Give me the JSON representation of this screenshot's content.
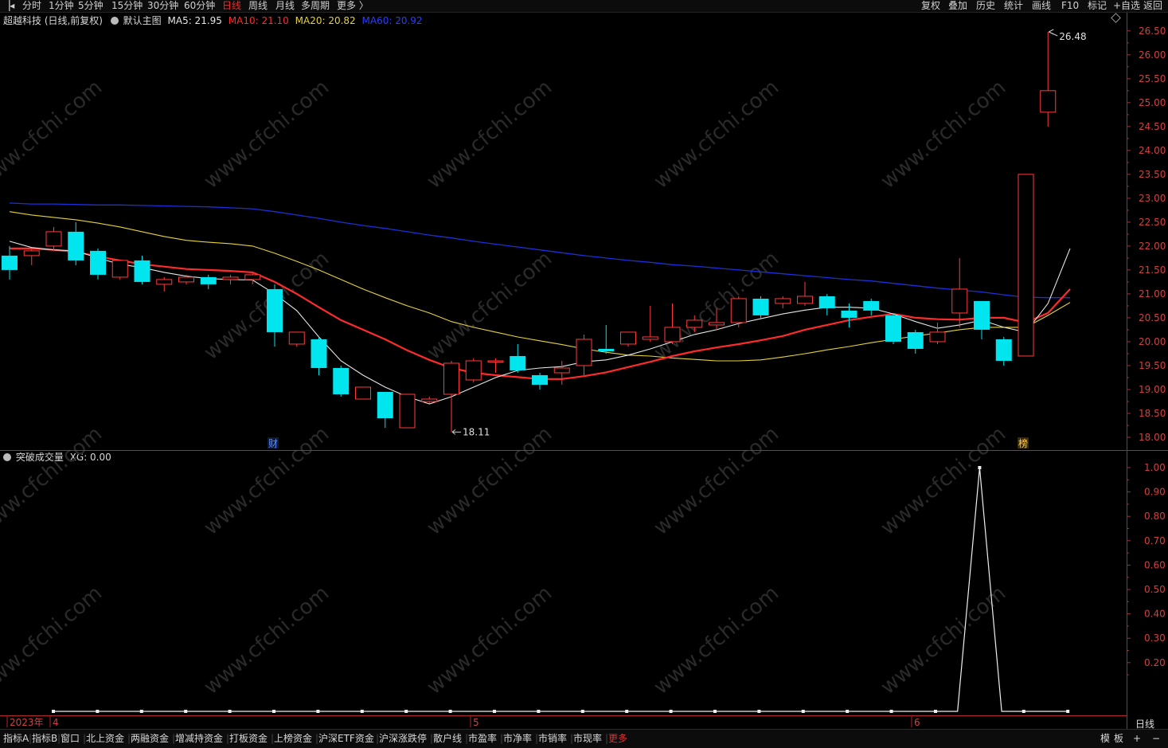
{
  "toolbar": {
    "back_icon": "chevron-left-icon",
    "periods": [
      "分时",
      "1分钟",
      "5分钟",
      "15分钟",
      "30分钟",
      "60分钟",
      "日线",
      "周线",
      "月线",
      "多周期",
      "更多 〉"
    ],
    "active_period": "日线",
    "right_buttons": [
      "复权",
      "叠加",
      "历史",
      "统计",
      "画线",
      "F10",
      "标记",
      "+自选",
      "返回"
    ]
  },
  "main_legend": {
    "stock": "超越科技 (日线,前复权)",
    "template_label": "默认主图",
    "ma5": "MA5: 21.95",
    "ma10": "MA10: 21.10",
    "ma20": "MA20: 20.82",
    "ma60": "MA60: 20.92",
    "colors": {
      "ma5": "#e6e6e6",
      "ma10": "#ff2b2b",
      "ma20": "#e6d23a",
      "ma60": "#1c2fd8",
      "up": "#ff3a3a",
      "down": "#00e5ee"
    }
  },
  "annotations": {
    "high": "26.48",
    "low": "18.11",
    "fin_marker": "财",
    "rank_marker": "榜"
  },
  "sub_legend": {
    "name": "突破成交量",
    "xg": "XG: 0.00"
  },
  "x_labels": {
    "start": "2023年",
    "m4": "4",
    "m5": "5",
    "m6": "6"
  },
  "corner_label": "日线",
  "bottom_buttons": [
    "指标A",
    "指标B",
    "窗口",
    "北上资金",
    "两融资金",
    "增减持资金",
    "打板资金",
    "上榜资金",
    "沪深ETF资金",
    "沪深涨跌停",
    "散户线",
    "市盈率",
    "市净率",
    "市销率",
    "市现率",
    "更多"
  ],
  "bottom_right": [
    "模",
    "板",
    "+",
    "−"
  ],
  "watermark": "www.cfchi.com",
  "chart_data": [
    {
      "type": "candlestick",
      "title": "超越科技 (日线,前复权)",
      "ylim": [
        17.8,
        26.7
      ],
      "yticks": [
        "18.00",
        "18.50",
        "19.00",
        "19.50",
        "20.00",
        "20.50",
        "21.00",
        "21.50",
        "22.00",
        "22.50",
        "23.00",
        "23.50",
        "24.00",
        "24.50",
        "25.00",
        "25.50",
        "26.00",
        "26.50"
      ],
      "candles": [
        {
          "o": 21.8,
          "h": 22.0,
          "c": 21.5,
          "l": 21.3
        },
        {
          "o": 21.8,
          "h": 21.95,
          "c": 21.9,
          "l": 21.6
        },
        {
          "o": 22.0,
          "h": 22.4,
          "c": 22.3,
          "l": 21.9
        },
        {
          "o": 22.3,
          "h": 22.5,
          "c": 21.7,
          "l": 21.6
        },
        {
          "o": 21.9,
          "h": 21.95,
          "c": 21.4,
          "l": 21.3
        },
        {
          "o": 21.35,
          "h": 21.7,
          "c": 21.7,
          "l": 21.3
        },
        {
          "o": 21.7,
          "h": 21.8,
          "c": 21.25,
          "l": 21.2
        },
        {
          "o": 21.2,
          "h": 21.35,
          "c": 21.3,
          "l": 21.05
        },
        {
          "o": 21.25,
          "h": 21.4,
          "c": 21.35,
          "l": 21.2
        },
        {
          "o": 21.35,
          "h": 21.4,
          "c": 21.2,
          "l": 21.1
        },
        {
          "o": 21.3,
          "h": 21.4,
          "c": 21.35,
          "l": 21.2
        },
        {
          "o": 21.3,
          "h": 21.45,
          "c": 21.4,
          "l": 21.2
        },
        {
          "o": 21.1,
          "h": 21.2,
          "c": 20.2,
          "l": 19.9
        },
        {
          "o": 19.95,
          "h": 20.2,
          "c": 20.2,
          "l": 19.9
        },
        {
          "o": 20.05,
          "h": 20.1,
          "c": 19.45,
          "l": 19.3
        },
        {
          "o": 19.45,
          "h": 19.5,
          "c": 18.9,
          "l": 18.85
        },
        {
          "o": 18.8,
          "h": 19.0,
          "c": 19.05,
          "l": 18.8
        },
        {
          "o": 18.95,
          "h": 18.95,
          "c": 18.4,
          "l": 18.2
        },
        {
          "o": 18.2,
          "h": 18.9,
          "c": 18.9,
          "l": 18.2
        },
        {
          "o": 18.75,
          "h": 18.85,
          "c": 18.8,
          "l": 18.72
        },
        {
          "o": 18.9,
          "h": 19.6,
          "c": 19.55,
          "l": 18.11
        },
        {
          "o": 19.2,
          "h": 19.65,
          "c": 19.6,
          "l": 19.15
        },
        {
          "o": 19.6,
          "h": 19.65,
          "c": 19.6,
          "l": 19.35
        },
        {
          "o": 19.7,
          "h": 19.95,
          "c": 19.4,
          "l": 19.35
        },
        {
          "o": 19.3,
          "h": 19.35,
          "c": 19.1,
          "l": 19.0
        },
        {
          "o": 19.35,
          "h": 19.6,
          "c": 19.45,
          "l": 19.1
        },
        {
          "o": 19.5,
          "h": 20.15,
          "c": 20.05,
          "l": 19.3
        },
        {
          "o": 19.85,
          "h": 20.35,
          "c": 19.8,
          "l": 19.75
        },
        {
          "o": 19.95,
          "h": 20.2,
          "c": 20.2,
          "l": 19.9
        },
        {
          "o": 20.05,
          "h": 20.75,
          "c": 20.1,
          "l": 20.0
        },
        {
          "o": 20.0,
          "h": 20.8,
          "c": 20.3,
          "l": 19.95
        },
        {
          "o": 20.3,
          "h": 20.55,
          "c": 20.45,
          "l": 20.2
        },
        {
          "o": 20.35,
          "h": 20.7,
          "c": 20.4,
          "l": 20.25
        },
        {
          "o": 20.4,
          "h": 20.95,
          "c": 20.9,
          "l": 20.3
        },
        {
          "o": 20.9,
          "h": 20.95,
          "c": 20.55,
          "l": 20.5
        },
        {
          "o": 20.8,
          "h": 20.95,
          "c": 20.9,
          "l": 20.7
        },
        {
          "o": 20.8,
          "h": 21.25,
          "c": 20.95,
          "l": 20.75
        },
        {
          "o": 20.95,
          "h": 21.0,
          "c": 20.7,
          "l": 20.55
        },
        {
          "o": 20.65,
          "h": 20.8,
          "c": 20.5,
          "l": 20.3
        },
        {
          "o": 20.85,
          "h": 20.9,
          "c": 20.65,
          "l": 20.55
        },
        {
          "o": 20.55,
          "h": 20.6,
          "c": 20.0,
          "l": 19.95
        },
        {
          "o": 20.2,
          "h": 20.25,
          "c": 19.85,
          "l": 19.75
        },
        {
          "o": 20.0,
          "h": 20.4,
          "c": 20.2,
          "l": 19.95
        },
        {
          "o": 20.6,
          "h": 21.75,
          "c": 21.1,
          "l": 20.3
        },
        {
          "o": 20.85,
          "h": 20.85,
          "c": 20.25,
          "l": 20.05
        },
        {
          "o": 20.05,
          "h": 20.1,
          "c": 19.6,
          "l": 19.5
        },
        {
          "o": 19.7,
          "h": 23.5,
          "c": 23.5,
          "l": 19.7
        },
        {
          "o": 24.8,
          "h": 26.48,
          "c": 25.25,
          "l": 24.5
        }
      ],
      "ma": {
        "ma5": [
          22.1,
          21.97,
          21.92,
          21.9,
          21.75,
          21.62,
          21.55,
          21.45,
          21.37,
          21.32,
          21.3,
          21.29,
          21.0,
          20.65,
          20.1,
          19.6,
          19.3,
          19.05,
          18.85,
          18.7,
          18.85,
          19.05,
          19.25,
          19.4,
          19.45,
          19.48,
          19.58,
          19.62,
          19.72,
          19.85,
          20.0,
          20.15,
          20.25,
          20.38,
          20.48,
          20.58,
          20.66,
          20.72,
          20.72,
          20.7,
          20.58,
          20.42,
          20.28,
          20.35,
          20.45,
          20.3,
          20.2,
          20.8,
          21.95
        ],
        "ma10": [
          21.95,
          21.95,
          21.92,
          21.88,
          21.78,
          21.7,
          21.62,
          21.57,
          21.52,
          21.5,
          21.48,
          21.45,
          21.25,
          21.0,
          20.72,
          20.45,
          20.25,
          20.05,
          19.82,
          19.62,
          19.45,
          19.35,
          19.3,
          19.26,
          19.22,
          19.22,
          19.28,
          19.36,
          19.47,
          19.58,
          19.7,
          19.8,
          19.88,
          19.95,
          20.03,
          20.12,
          20.25,
          20.35,
          20.45,
          20.52,
          20.58,
          20.5,
          20.47,
          20.46,
          20.5,
          20.5,
          20.4,
          20.6,
          21.1
        ],
        "ma20": [
          22.72,
          22.65,
          22.6,
          22.55,
          22.48,
          22.4,
          22.3,
          22.2,
          22.12,
          22.08,
          22.05,
          22.0,
          21.85,
          21.68,
          21.5,
          21.3,
          21.1,
          20.92,
          20.75,
          20.6,
          20.42,
          20.3,
          20.2,
          20.1,
          20.02,
          19.94,
          19.85,
          19.78,
          19.72,
          19.7,
          19.66,
          19.63,
          19.6,
          19.6,
          19.62,
          19.68,
          19.75,
          19.83,
          19.9,
          19.98,
          20.05,
          20.12,
          20.18,
          20.25,
          20.3,
          20.3,
          20.3,
          20.55,
          20.82
        ],
        "ma60": [
          22.9,
          22.88,
          22.88,
          22.87,
          22.86,
          22.86,
          22.85,
          22.84,
          22.83,
          22.82,
          22.8,
          22.78,
          22.72,
          22.65,
          22.58,
          22.5,
          22.43,
          22.37,
          22.3,
          22.23,
          22.17,
          22.1,
          22.04,
          21.98,
          21.92,
          21.86,
          21.8,
          21.75,
          21.7,
          21.66,
          21.61,
          21.58,
          21.54,
          21.5,
          21.46,
          21.42,
          21.38,
          21.34,
          21.3,
          21.27,
          21.22,
          21.17,
          21.12,
          21.08,
          21.04,
          20.98,
          20.93,
          20.92,
          20.92
        ]
      }
    },
    {
      "type": "line",
      "title": "突破成交量",
      "ylim": [
        0,
        1.05
      ],
      "yticks": [
        "0.20",
        "0.30",
        "0.40",
        "0.50",
        "0.60",
        "0.70",
        "0.80",
        "0.90",
        "1.00"
      ],
      "values": [
        0,
        0,
        0,
        0,
        0,
        0,
        0,
        0,
        0,
        0,
        0,
        0,
        0,
        0,
        0,
        0,
        0,
        0,
        0,
        0,
        0,
        0,
        0,
        0,
        0,
        0,
        0,
        0,
        0,
        0,
        0,
        0,
        0,
        0,
        0,
        0,
        0,
        0,
        0,
        0,
        0,
        0,
        1,
        0,
        0,
        0,
        0
      ]
    }
  ]
}
